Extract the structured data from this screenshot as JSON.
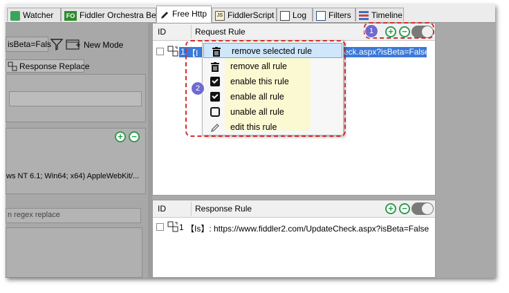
{
  "tabs": [
    {
      "label": "Watcher",
      "icon": "watcher-icon"
    },
    {
      "label": "Fiddler Orchestra Beta",
      "icon": "fo-icon",
      "icon_text": "FO"
    },
    {
      "label": "Free Http",
      "icon": "pencil-icon"
    },
    {
      "label": "FiddlerScript",
      "icon": "script-icon",
      "icon_text": "JS"
    },
    {
      "label": "Log",
      "icon": "log-icon"
    },
    {
      "label": "Filters",
      "icon": "filters-icon"
    },
    {
      "label": "Timeline",
      "icon": "timeline-icon"
    }
  ],
  "left": {
    "url_field": "isBeta=Fals",
    "new_mode": "New Mode",
    "response_replace_tab": "Response Replace",
    "user_agent": "ws NT 6.1; Win64; x64) AppleWebKit/...",
    "regex_placeholder": "n regex replace"
  },
  "request_rule": {
    "col_id": "ID",
    "col_rule": "Request Rule",
    "row_id": "1",
    "row_prefix": "【I",
    "row_url_tail": "eck.aspx?isBeta=False"
  },
  "response_rule": {
    "col_id": "ID",
    "col_rule": "Response Rule",
    "row_id": "1",
    "row_text": "【Is】: https://www.fiddler2.com/UpdateCheck.aspx?isBeta=False"
  },
  "context_menu": [
    {
      "label": "remove selected rule",
      "icon": "trash-icon",
      "selected": true
    },
    {
      "label": "remove all rule",
      "icon": "trash-icon"
    },
    {
      "label": "enable this rule",
      "icon": "checkbox-checked-icon"
    },
    {
      "label": "enable all rule",
      "icon": "checkbox-checked-icon"
    },
    {
      "label": "unable all rule",
      "icon": "checkbox-empty-icon"
    },
    {
      "label": "edit this rule",
      "icon": "pencil-icon"
    }
  ],
  "badges": {
    "one": "1",
    "two": "2"
  },
  "symbols": {
    "plus": "+",
    "minus": "−"
  },
  "colors": {
    "accent_green": "#2e9b4d",
    "badge_purple": "#6f6ad1",
    "highlight_dash": "#d42a2a",
    "selection": "#3a79d9"
  }
}
